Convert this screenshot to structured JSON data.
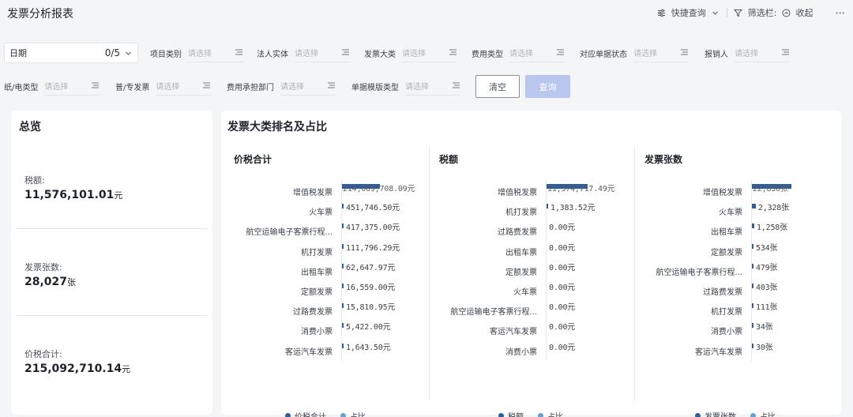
{
  "header": {
    "title": "发票分析报表",
    "quick_query": "快捷查询",
    "filter_bar": "筛选栏:",
    "collapse": "收起",
    "more": "···"
  },
  "filters": {
    "date_label": "日期",
    "date_count": "0/5",
    "placeholder": "请选择",
    "row1": [
      "项目类别",
      "法人实体",
      "发票大类",
      "费用类型",
      "对应单据状态",
      "报销人"
    ],
    "row2": [
      "纸/电类型",
      "普/专发票",
      "费用承担部门",
      "单据模版类型"
    ],
    "clear_label": "清空",
    "query_label": "查询"
  },
  "overview": {
    "title": "总览",
    "items": [
      {
        "label": "税额:",
        "value": "11,576,101.01",
        "unit": "元"
      },
      {
        "label": "发票张数:",
        "value": "28,027",
        "unit": "张"
      },
      {
        "label": "价税合计:",
        "value": "215,092,710.14",
        "unit": "元"
      }
    ]
  },
  "main": {
    "title": "发票大类排名及占比"
  },
  "colors": {
    "bar": "#2e5d9a",
    "legend_main": "#2e5d9a",
    "legend_ratio": "#6a9fce"
  },
  "chart_data": [
    {
      "type": "bar",
      "title": "价税合计",
      "categories": [
        "增值税发票",
        "火车票",
        "航空运输电子客票行程...",
        "机打发票",
        "出租车票",
        "定额发票",
        "过路费发票",
        "消费小票",
        "客运汽车发票"
      ],
      "values": [
        214009708.09,
        451746.5,
        417375.0,
        111796.29,
        62647.97,
        16559.0,
        15810.95,
        5422.0,
        1643.5
      ],
      "labels": [
        "214,009,708.09元",
        "451,746.50元",
        "417,375.00元",
        "111,796.29元",
        "62,647.97元",
        "16,559.00元",
        "15,810.95元",
        "5,422.00元",
        "1,643.50元"
      ],
      "legend": [
        "价税合计",
        "占比"
      ]
    },
    {
      "type": "bar",
      "title": "税额",
      "categories": [
        "增值税发票",
        "机打发票",
        "过路费发票",
        "出租车票",
        "定额发票",
        "火车票",
        "航空运输电子客票行程...",
        "客运汽车发票",
        "消费小票"
      ],
      "values": [
        11574717.49,
        1383.52,
        0,
        0,
        0,
        0,
        0,
        0,
        0
      ],
      "labels": [
        "11,574,717.49元",
        "1,383.52元",
        "0.00元",
        "0.00元",
        "0.00元",
        "0.00元",
        "0.00元",
        "0.00元",
        "0.00元"
      ],
      "legend": [
        "税额",
        "占比"
      ]
    },
    {
      "type": "bar",
      "title": "发票张数",
      "categories": [
        "增值税发票",
        "火车票",
        "出租车票",
        "定额发票",
        "航空运输电子客票行程...",
        "过路费发票",
        "机打发票",
        "消费小票",
        "客运汽车发票"
      ],
      "values": [
        22850,
        2328,
        1258,
        534,
        479,
        403,
        111,
        34,
        30
      ],
      "labels": [
        "22,850张",
        "2,328张",
        "1,258张",
        "534张",
        "479张",
        "403张",
        "111张",
        "34张",
        "30张"
      ],
      "legend": [
        "发票张数",
        "占比"
      ]
    }
  ]
}
